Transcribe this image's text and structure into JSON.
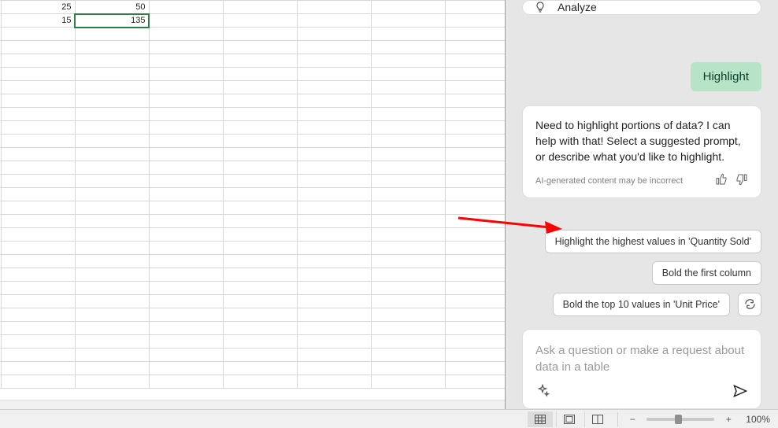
{
  "sheet": {
    "cells": [
      {
        "r": 0,
        "c": 0,
        "v": "25"
      },
      {
        "r": 0,
        "c": 1,
        "v": "50"
      },
      {
        "r": 1,
        "c": 0,
        "v": "15"
      },
      {
        "r": 1,
        "c": 1,
        "v": "135",
        "active": true
      }
    ],
    "rows": 29,
    "cols": 7
  },
  "panel": {
    "analyze_label": "Analyze",
    "user_message": "Highlight",
    "response": "Need to highlight portions of data? I can help with that! Select a suggested prompt, or describe what you'd like to highlight.",
    "disclaimer": "AI-generated content may be incorrect",
    "suggestions": [
      "Highlight the highest values in 'Quantity Sold'",
      "Bold the first column",
      "Bold the top 10 values in 'Unit Price'"
    ],
    "input_placeholder": "Ask a question or make a request about data in a table"
  },
  "statusbar": {
    "zoom_label": "100%",
    "minus": "−",
    "plus": "+"
  },
  "colors": {
    "accent_green": "#b7e4c7",
    "arrow_red": "#ff0000"
  }
}
